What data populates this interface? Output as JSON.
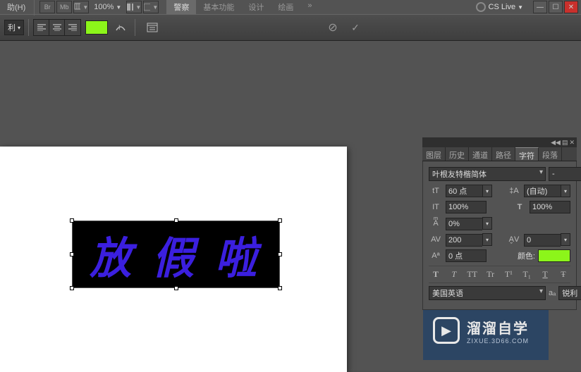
{
  "menu": {
    "help": "助(H)"
  },
  "toolbar": {
    "br_label": "Br",
    "mb_label": "Mb",
    "zoom": "100%"
  },
  "workspace": {
    "tabs": [
      "警察",
      "基本功能",
      "设计",
      "绘画"
    ],
    "more": "»",
    "cs_live": "CS Live",
    "cs_dropdown": "▼"
  },
  "options": {
    "mode_suffix": "利",
    "color_swatch": "#8cf51a",
    "cancel_icon": "⊘",
    "commit_icon": "✓"
  },
  "canvas": {
    "text": "放 假 啦"
  },
  "char_panel": {
    "tabs": [
      "图层",
      "历史",
      "通道",
      "路径",
      "字符",
      "段落"
    ],
    "active_tab": 4,
    "font_family": "叶根友特楷简体",
    "font_style": "-",
    "font_size": "60 点",
    "leading": "(自动)",
    "vscale": "100%",
    "hscale": "100%",
    "baseline_pct": "0%",
    "tracking": "200",
    "kerning": "0",
    "baseline_shift": "0 点",
    "color_label": "颜色:",
    "text_color": "#8cf51a",
    "tt_buttons": [
      "T",
      "T",
      "TT",
      "Tr",
      "T¹",
      "T₁",
      "T",
      "Ŧ"
    ],
    "language": "美国英语",
    "aa_label": "aₐ",
    "aa_method": "锐利"
  },
  "watermark": {
    "main": "溜溜自学",
    "sub": "ZIXUE.3D66.COM"
  }
}
